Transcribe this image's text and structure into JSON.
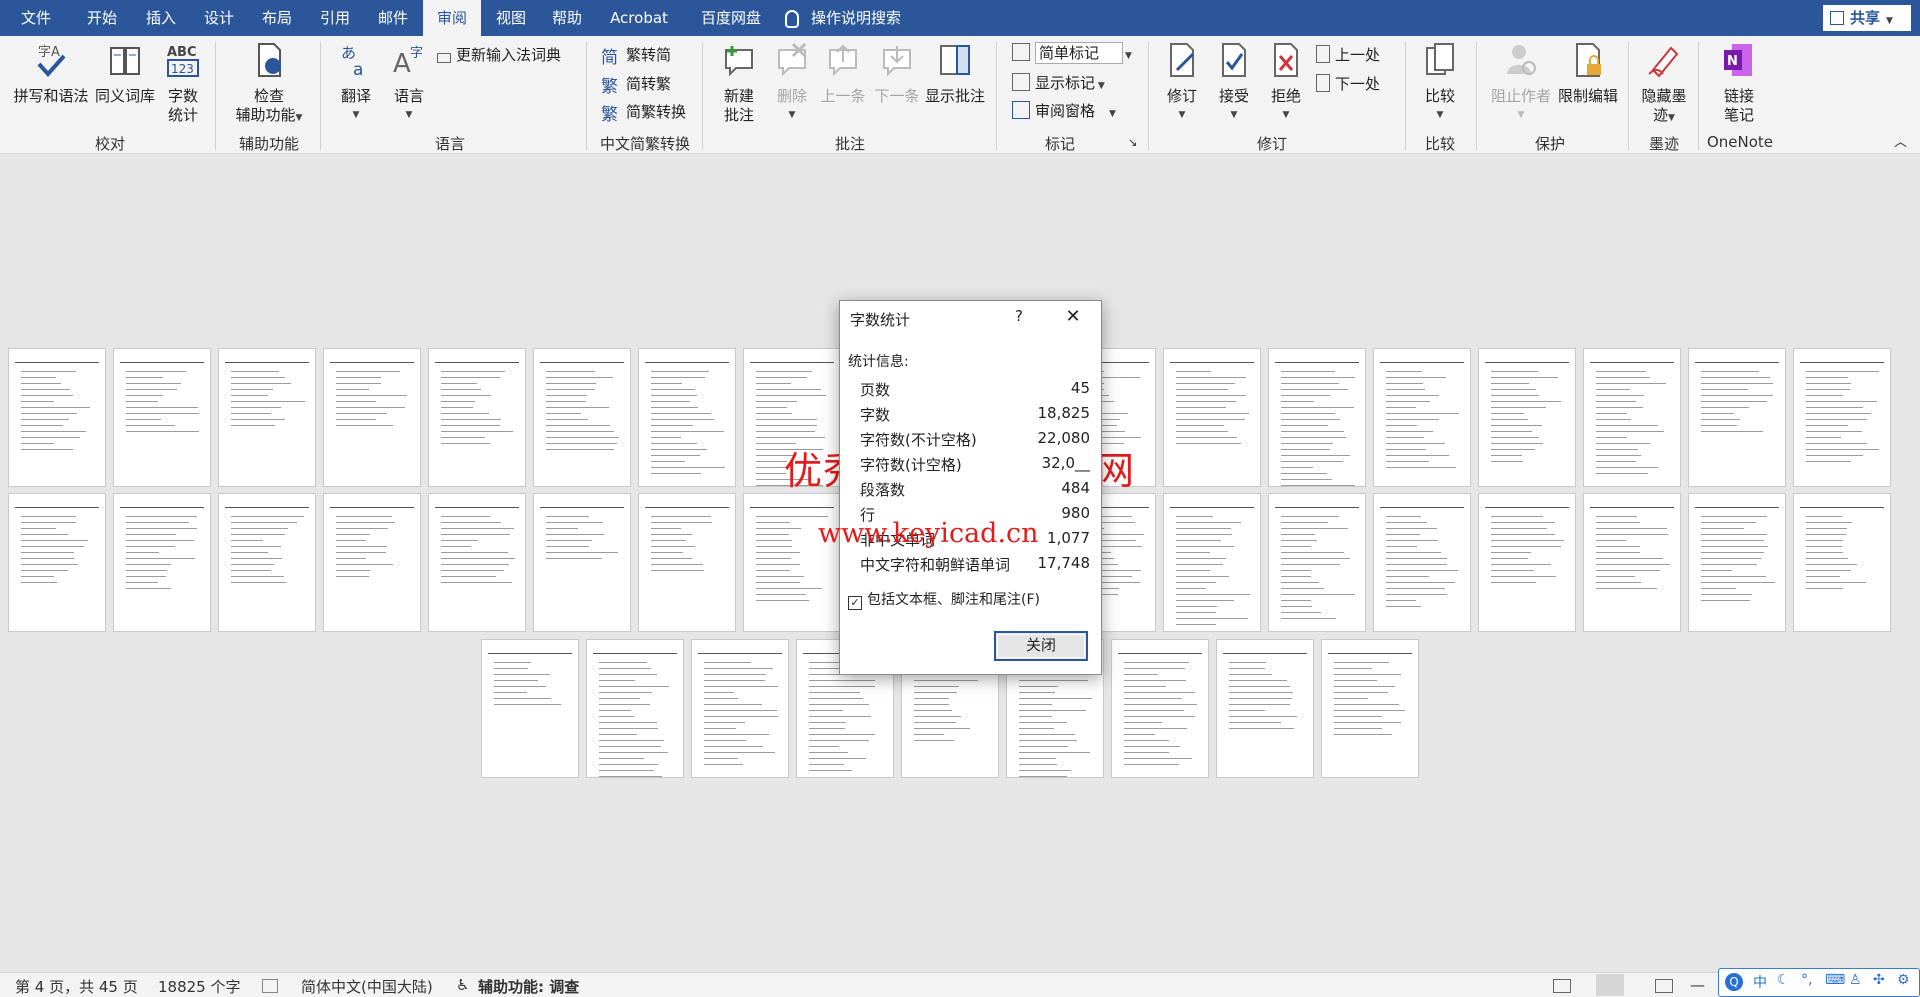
{
  "tabs": [
    "文件",
    "开始",
    "插入",
    "设计",
    "布局",
    "引用",
    "邮件",
    "审阅",
    "视图",
    "帮助",
    "Acrobat",
    "百度网盘"
  ],
  "active_tab": "审阅",
  "tell_me": "操作说明搜索",
  "share": "共享",
  "ribbon": {
    "proofing": {
      "spelling": "拼写和语法",
      "thesaurus": "同义词库",
      "wordcount_1": "字数",
      "wordcount_2": "统计",
      "label": "校对"
    },
    "accessibility": {
      "check_1": "检查",
      "check_2": "辅助功能",
      "label": "辅助功能"
    },
    "language": {
      "translate": "翻译",
      "language": "语言",
      "ime_dict": "更新输入法词典",
      "label": "语言"
    },
    "chinese": {
      "t2s": "繁转简",
      "s2t": "简转繁",
      "convert": "简繁转换",
      "label": "中文简繁转换"
    },
    "comments": {
      "new_1": "新建",
      "new_2": "批注",
      "delete": "删除",
      "prev": "上一条",
      "next": "下一条",
      "show": "显示批注",
      "label": "批注"
    },
    "tracking": {
      "markup": "简单标记",
      "show_markup": "显示标记",
      "pane": "审阅窗格",
      "label": "标记"
    },
    "changes": {
      "track": "修订",
      "accept": "接受",
      "reject": "拒绝",
      "previous": "上一处",
      "next": "下一处",
      "label": "修订"
    },
    "compare": {
      "compare": "比较",
      "label": "比较"
    },
    "protect": {
      "block": "阻止作者",
      "restrict": "限制编辑",
      "label": "保护"
    },
    "ink": {
      "hide_1": "隐藏墨",
      "hide_2": "迹",
      "label": "墨迹"
    },
    "onenote": {
      "link_1": "链接",
      "link_2": "笔记",
      "label": "OneNote"
    }
  },
  "dialog": {
    "title": "字数统计",
    "help": "?",
    "section": "统计信息:",
    "stats": [
      {
        "label": "页数",
        "value": "45"
      },
      {
        "label": "字数",
        "value": "18,825"
      },
      {
        "label": "字符数(不计空格)",
        "value": "22,080"
      },
      {
        "label": "字符数(计空格)",
        "value": "32,0__"
      },
      {
        "label": "段落数",
        "value": "484"
      },
      {
        "label": "行",
        "value": "980"
      },
      {
        "label": "非中文单词",
        "value": "1,077"
      },
      {
        "label": "中文字符和朝鲜语单词",
        "value": "17,748"
      }
    ],
    "checkbox": "包括文本框、脚注和尾注(F)",
    "checked": true,
    "close": "关闭"
  },
  "watermark": {
    "line1": "优秀毕业设计资源网",
    "line2": "www.keyicad.cn"
  },
  "status": {
    "page": "第 4 页，共 45 页",
    "words": "18825 个字",
    "lang": "简体中文(中国大陆)",
    "accessibility": "辅助功能: 调查"
  },
  "ime": {
    "lang": "中"
  },
  "colors": {
    "accent": "#2b579a",
    "watermark": "#e51a1a"
  }
}
